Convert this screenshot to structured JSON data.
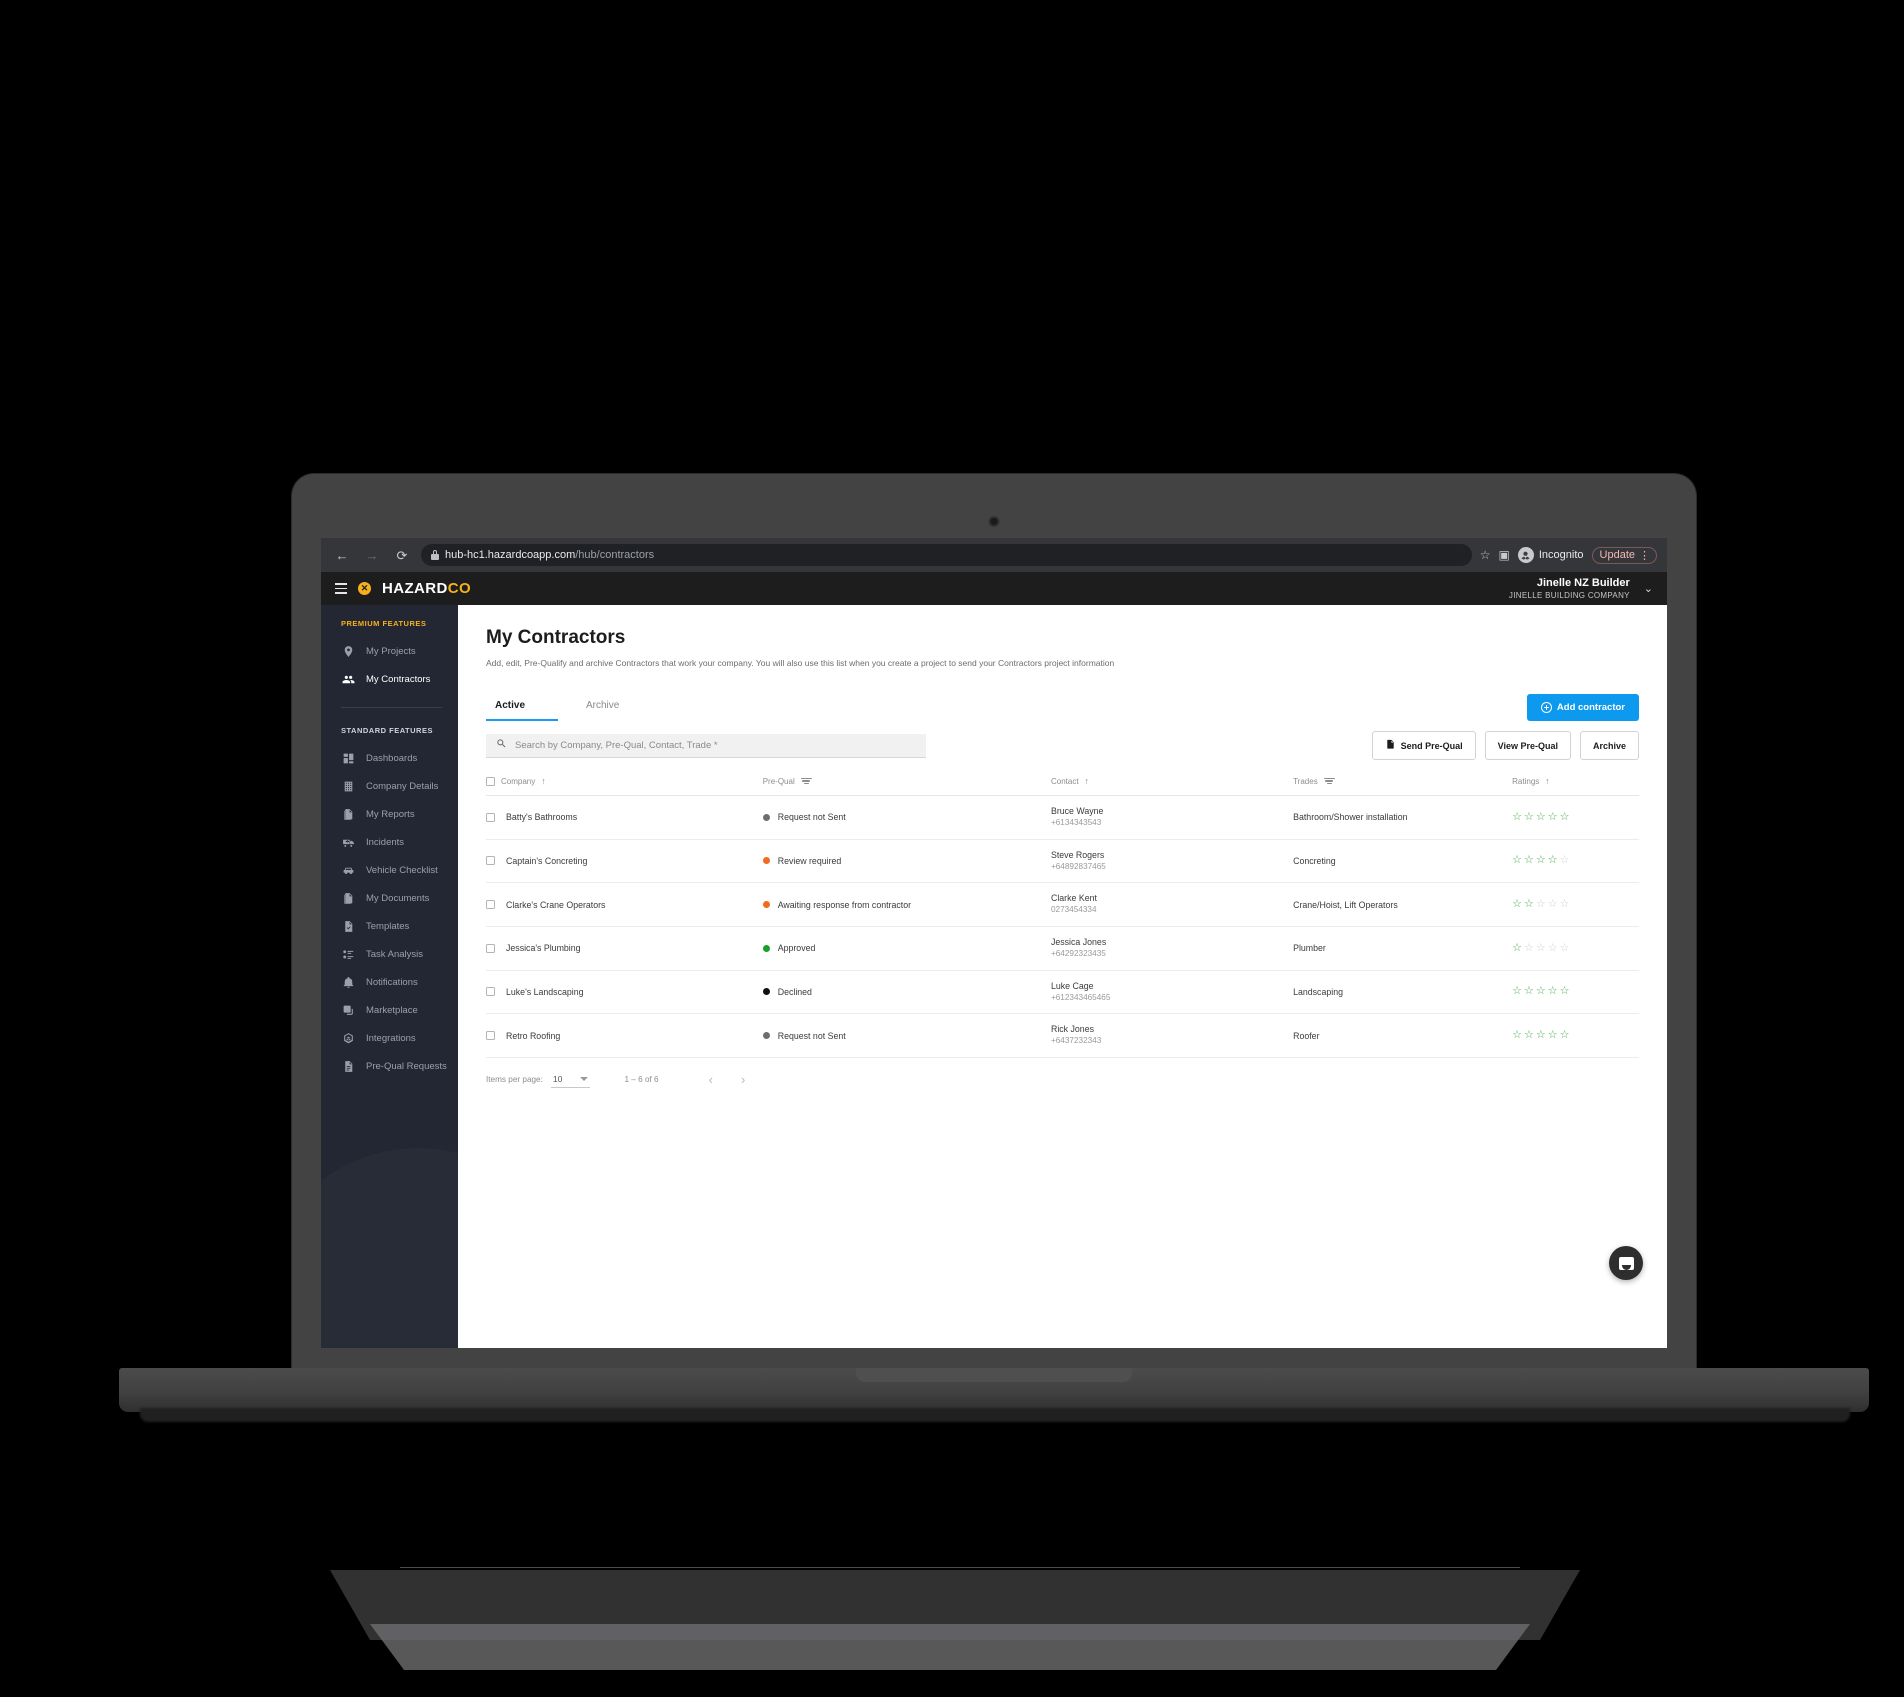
{
  "browser": {
    "url_host": "hub-hc1.hazardcoapp.com",
    "url_path": "/hub/contractors",
    "back_icon": "back-arrow-icon",
    "forward_icon": "forward-arrow-icon",
    "reload_icon": "reload-icon",
    "bookmark_icon": "star-icon",
    "sidepanel_icon": "side-panel-icon",
    "incognito_label": "Incognito",
    "update_label": "Update",
    "menu_icon": "kebab-menu-icon"
  },
  "topbar": {
    "menu_icon": "hamburger-icon",
    "logo_mark": "x",
    "logo_main": "HAZARD",
    "logo_accent": "CO",
    "user_name": "Jinelle NZ Builder",
    "user_company": "JINELLE BUILDING COMPANY",
    "chevron": "chevron-down-icon"
  },
  "sidebar": {
    "premium_label": "PREMIUM FEATURES",
    "standard_label": "STANDARD FEATURES",
    "premium_items": [
      {
        "label": "My Projects",
        "icon": "location-pin-icon",
        "active": false
      },
      {
        "label": "My Contractors",
        "icon": "people-icon",
        "active": true
      }
    ],
    "standard_items": [
      {
        "label": "Dashboards",
        "icon": "dashboard-grid-icon"
      },
      {
        "label": "Company Details",
        "icon": "building-icon"
      },
      {
        "label": "My Reports",
        "icon": "documents-icon"
      },
      {
        "label": "Incidents",
        "icon": "ambulance-icon"
      },
      {
        "label": "Vehicle Checklist",
        "icon": "car-icon"
      },
      {
        "label": "My Documents",
        "icon": "documents-icon"
      },
      {
        "label": "Templates",
        "icon": "document-check-icon"
      },
      {
        "label": "Task Analysis",
        "icon": "task-list-icon"
      },
      {
        "label": "Notifications",
        "icon": "bell-icon"
      },
      {
        "label": "Marketplace",
        "icon": "marketplace-icon"
      },
      {
        "label": "Integrations",
        "icon": "integrations-icon"
      },
      {
        "label": "Pre-Qual Requests",
        "icon": "document-lines-icon"
      }
    ]
  },
  "page": {
    "title": "My Contractors",
    "subtitle": "Add, edit, Pre-Qualify and archive Contractors that work your company. You will also use this list when you create a project to send your Contractors project information"
  },
  "tabs": [
    {
      "label": "Active",
      "active": true
    },
    {
      "label": "Archive",
      "active": false
    }
  ],
  "actions": {
    "add_contractor": "Add contractor",
    "add_icon": "plus-circle-icon",
    "send_prequal": "Send Pre-Qual",
    "send_prequal_icon": "send-document-icon",
    "view_prequal": "View Pre-Qual",
    "archive": "Archive"
  },
  "search": {
    "placeholder": "Search by Company, Pre-Qual, Contact, Trade *",
    "value": "",
    "icon": "search-icon"
  },
  "table": {
    "columns": [
      {
        "label": "Company",
        "sort": "ascending",
        "sort_icon": "arrow-up-icon"
      },
      {
        "label": "Pre-Qual",
        "filter_icon": "filter-icon"
      },
      {
        "label": "Contact",
        "sort": "ascending",
        "sort_icon": "arrow-up-icon"
      },
      {
        "label": "Trades",
        "filter_icon": "filter-icon"
      },
      {
        "label": "Ratings",
        "sort": "ascending",
        "sort_icon": "arrow-up-icon"
      }
    ],
    "rows": [
      {
        "company": "Batty's Bathrooms",
        "prequal": "Request not Sent",
        "prequal_color": "#6e6e6e",
        "contact_name": "Bruce Wayne",
        "contact_phone": "+6134343543",
        "trade": "Bathroom/Shower installation",
        "rating": 5
      },
      {
        "company": "Captain's Concreting",
        "prequal": "Review required",
        "prequal_color": "#f26b21",
        "contact_name": "Steve Rogers",
        "contact_phone": "+64892837465",
        "trade": "Concreting",
        "rating": 4
      },
      {
        "company": "Clarke's Crane Operators",
        "prequal": "Awaiting response from contractor",
        "prequal_color": "#f26b21",
        "contact_name": "Clarke Kent",
        "contact_phone": "0273454334",
        "trade": "Crane/Hoist, Lift Operators",
        "rating": 2
      },
      {
        "company": "Jessica's Plumbing",
        "prequal": "Approved",
        "prequal_color": "#17a126",
        "contact_name": "Jessica Jones",
        "contact_phone": "+64292323435",
        "trade": "Plumber",
        "rating": 1
      },
      {
        "company": "Luke's Landscaping",
        "prequal": "Declined",
        "prequal_color": "#111111",
        "contact_name": "Luke Cage",
        "contact_phone": "+612343465465",
        "trade": "Landscaping",
        "rating": 5
      },
      {
        "company": "Retro Roofing",
        "prequal": "Request not Sent",
        "prequal_color": "#6e6e6e",
        "contact_name": "Rick Jones",
        "contact_phone": "+6437232343",
        "trade": "Roofer",
        "rating": 5
      }
    ]
  },
  "paginator": {
    "items_per_page_label": "Items per page:",
    "items_per_page_value": "10",
    "range": "1 – 6 of 6",
    "prev_icon": "chevron-left-icon",
    "next_icon": "chevron-right-icon"
  },
  "chat": {
    "icon": "chat-bubble-icon"
  },
  "colors": {
    "accent_blue": "#0d99ed",
    "brand_yellow": "#f5b21b",
    "sidebar_bg": "#232733",
    "topbar_bg": "#1d1d1d",
    "star_green": "#48a94b"
  }
}
